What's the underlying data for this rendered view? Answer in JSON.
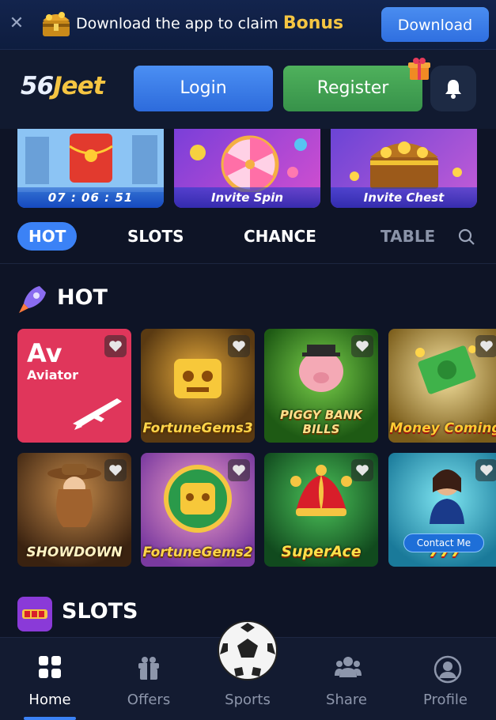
{
  "promo": {
    "message": "Download the app to claim ",
    "bonus": "Bonus",
    "download_label": "Download",
    "close_icon": "close-icon"
  },
  "header": {
    "logo_number": "56",
    "logo_text": "Jeet",
    "login_label": "Login",
    "register_label": "Register"
  },
  "banners": [
    {
      "caption": "07 : 06 : 51"
    },
    {
      "caption": "Invite Spin"
    },
    {
      "caption": "Invite Chest"
    }
  ],
  "tabs": [
    {
      "label": "HOT",
      "active": true
    },
    {
      "label": "SLOTS",
      "active": false
    },
    {
      "label": "CHANCE",
      "active": false
    },
    {
      "label": "TABLE",
      "active": false
    }
  ],
  "sections": {
    "hot_title": "HOT",
    "slots_title": "SLOTS"
  },
  "games": [
    {
      "name": "Aviator",
      "tag": "Av"
    },
    {
      "name": "FortuneGems3"
    },
    {
      "name": "PIGGY BANK BILLS"
    },
    {
      "name": "Money Coming"
    },
    {
      "name": "SHOWDOWN"
    },
    {
      "name": "FortuneGems2"
    },
    {
      "name": "SuperAce"
    },
    {
      "name": "777"
    }
  ],
  "contact_label": "Contact Me",
  "bottom_nav": [
    {
      "label": "Home",
      "active": true
    },
    {
      "label": "Offers"
    },
    {
      "label": "Sports"
    },
    {
      "label": "Share"
    },
    {
      "label": "Profile"
    }
  ],
  "colors": {
    "accent": "#3b82f6",
    "register": "#43a553",
    "bonus": "#f5c542",
    "background": "#0e1426"
  }
}
